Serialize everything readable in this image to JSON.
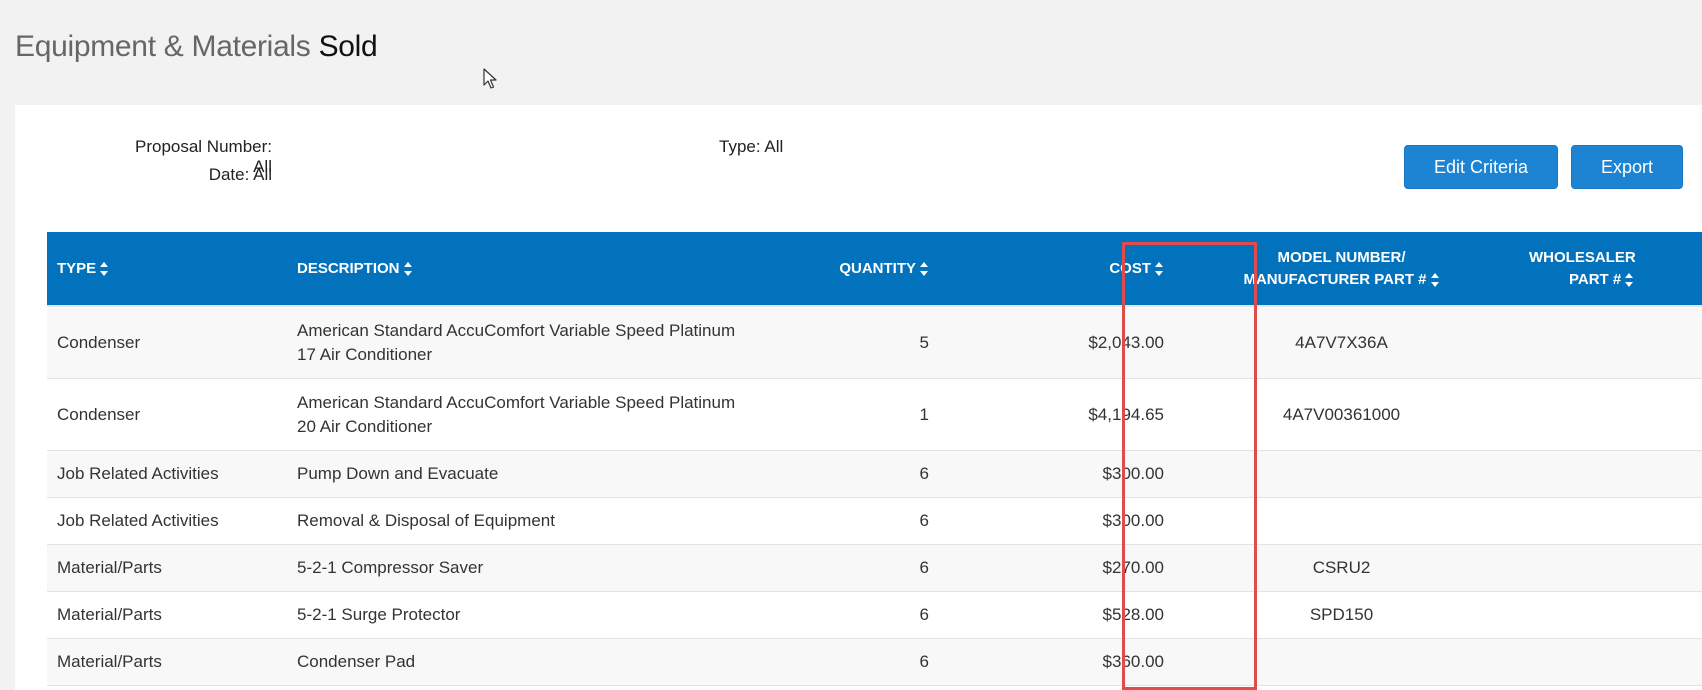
{
  "page": {
    "title_light": "Equipment & Materials",
    "title_bold": "Sold"
  },
  "criteria": {
    "proposal_number": "Proposal Number: All",
    "date": "Date: All",
    "type": "Type: All"
  },
  "buttons": {
    "edit_criteria": "Edit Criteria",
    "export": "Export"
  },
  "table": {
    "headers": {
      "type": "TYPE",
      "description": "DESCRIPTION",
      "quantity": "QUANTITY",
      "cost": "COST",
      "model_line1": "MODEL NUMBER/",
      "model_line2": "MANUFACTURER PART #",
      "wholesaler_line1": "WHOLESALER",
      "wholesaler_line2": "PART #"
    },
    "rows": [
      {
        "type": "Condenser",
        "description": "American Standard AccuComfort Variable Speed Platinum 17 Air Conditioner",
        "quantity": "5",
        "cost": "$2,043.00",
        "model": "4A7V7X36A",
        "wholesaler": ""
      },
      {
        "type": "Condenser",
        "description": "American Standard AccuComfort Variable Speed Platinum 20 Air Conditioner",
        "quantity": "1",
        "cost": "$4,194.65",
        "model": "4A7V00361000",
        "wholesaler": ""
      },
      {
        "type": "Job Related Activities",
        "description": "Pump Down and Evacuate",
        "quantity": "6",
        "cost": "$300.00",
        "model": "",
        "wholesaler": ""
      },
      {
        "type": "Job Related Activities",
        "description": "Removal & Disposal of Equipment",
        "quantity": "6",
        "cost": "$300.00",
        "model": "",
        "wholesaler": ""
      },
      {
        "type": "Material/Parts",
        "description": "5-2-1 Compressor Saver",
        "quantity": "6",
        "cost": "$270.00",
        "model": "CSRU2",
        "wholesaler": ""
      },
      {
        "type": "Material/Parts",
        "description": "5-2-1 Surge Protector",
        "quantity": "6",
        "cost": "$528.00",
        "model": "SPD150",
        "wholesaler": ""
      },
      {
        "type": "Material/Parts",
        "description": "Condenser Pad",
        "quantity": "6",
        "cost": "$360.00",
        "model": "",
        "wholesaler": ""
      }
    ]
  },
  "colors": {
    "header_bg": "#0372bc",
    "button_bg": "#1c84d3",
    "highlight": "#e04b4b"
  }
}
